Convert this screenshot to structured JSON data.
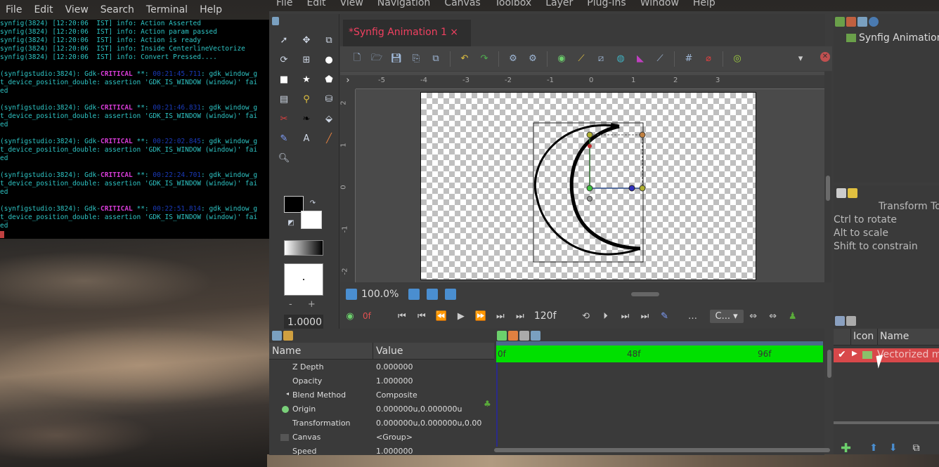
{
  "terminal_menu": [
    "File",
    "Edit",
    "View",
    "Search",
    "Terminal",
    "Help"
  ],
  "terminal_lines": [
    {
      "type": "info",
      "text": "synfig(3824) [12:20:06  IST] info: Action Asserted"
    },
    {
      "type": "info",
      "text": "synfig(3824) [12:20:06  IST] info: Action param passed"
    },
    {
      "type": "info",
      "text": "synfig(3824) [12:20:06  IST] info: Action is ready"
    },
    {
      "type": "info",
      "text": "synfig(3824) [12:20:06  IST] info: Inside CenterlineVectorize"
    },
    {
      "type": "info",
      "text": "synfig(3824) [12:20:06  IST] info: Convert Pressed...."
    },
    {
      "type": "blank",
      "text": ""
    },
    {
      "type": "crit",
      "prefix": "(synfigstudio:3824): Gdk-",
      "crit": "CRITICAL",
      "mid": " **: ",
      "ts": "00:21:45.711",
      "rest": ": gdk_window_g"
    },
    {
      "type": "info",
      "text": "t_device_position_double: assertion 'GDK_IS_WINDOW (window)' fai"
    },
    {
      "type": "info",
      "text": "ed"
    },
    {
      "type": "blank",
      "text": ""
    },
    {
      "type": "crit",
      "prefix": "(synfigstudio:3824): Gdk-",
      "crit": "CRITICAL",
      "mid": " **: ",
      "ts": "00:21:46.831",
      "rest": ": gdk_window_g"
    },
    {
      "type": "info",
      "text": "t_device_position_double: assertion 'GDK_IS_WINDOW (window)' fai"
    },
    {
      "type": "info",
      "text": "ed"
    },
    {
      "type": "blank",
      "text": ""
    },
    {
      "type": "crit",
      "prefix": "(synfigstudio:3824): Gdk-",
      "crit": "CRITICAL",
      "mid": " **: ",
      "ts": "00:22:02.845",
      "rest": ": gdk_window_g"
    },
    {
      "type": "info",
      "text": "t_device_position_double: assertion 'GDK_IS_WINDOW (window)' fai"
    },
    {
      "type": "info",
      "text": "ed"
    },
    {
      "type": "blank",
      "text": ""
    },
    {
      "type": "crit",
      "prefix": "(synfigstudio:3824): Gdk-",
      "crit": "CRITICAL",
      "mid": " **: ",
      "ts": "00:22:24.701",
      "rest": ": gdk_window_g"
    },
    {
      "type": "info",
      "text": "t_device_position_double: assertion 'GDK_IS_WINDOW (window)' fai"
    },
    {
      "type": "info",
      "text": "ed"
    },
    {
      "type": "blank",
      "text": ""
    },
    {
      "type": "crit",
      "prefix": "(synfigstudio:3824): Gdk-",
      "crit": "CRITICAL",
      "mid": " **: ",
      "ts": "00:22:51.814",
      "rest": ": gdk_window_g"
    },
    {
      "type": "info",
      "text": "t_device_position_double: assertion 'GDK_IS_WINDOW (window)' fai"
    },
    {
      "type": "info",
      "text": "ed"
    }
  ],
  "synfig_menu": [
    "File",
    "Edit",
    "View",
    "Navigation",
    "Canvas",
    "Toolbox",
    "Layer",
    "Plug-Ins",
    "Window",
    "Help"
  ],
  "document": {
    "tab_title": "*Synfig Animation 1",
    "close_glyph": "×"
  },
  "ruler": {
    "h_ticks": [
      "-5",
      "-4",
      "-3",
      "-2",
      "-1",
      "0",
      "1",
      "2",
      "3"
    ],
    "v_ticks": [
      "2",
      "1",
      "0",
      "-1",
      "-2"
    ]
  },
  "zoom": {
    "value": "100.0%"
  },
  "playback": {
    "current_frame": "0f",
    "end_frame": "120f",
    "keyframe_lock": "C..."
  },
  "toolbox": {
    "brush_size_minus": "-",
    "brush_size_plus": "+",
    "width_value": "1.0000"
  },
  "params": {
    "col_name": "Name",
    "col_value": "Value",
    "rows": [
      {
        "name": "Z Depth",
        "value": "0.000000",
        "mark": "none"
      },
      {
        "name": "Opacity",
        "value": "1.000000",
        "mark": "none"
      },
      {
        "name": "Blend Method",
        "value": "Composite",
        "mark": "tri"
      },
      {
        "name": "Origin",
        "value": "0.000000u,0.000000u",
        "mark": "dot"
      },
      {
        "name": "Transformation",
        "value": "0.000000u,0.000000u,0.00",
        "mark": "none"
      },
      {
        "name": "Canvas",
        "value": "<Group>",
        "mark": "sq"
      },
      {
        "name": "Speed",
        "value": "1.000000",
        "mark": "none"
      }
    ]
  },
  "timetrack": {
    "labels": [
      "0f",
      "48f",
      "96f"
    ]
  },
  "canvas_browser": {
    "item": "Synfig Animation"
  },
  "tool_options": {
    "title": "Transform To",
    "hints": [
      "Ctrl to rotate",
      "Alt to scale",
      "Shift to constrain"
    ]
  },
  "layers": {
    "col_icon": "Icon",
    "col_name": "Name",
    "layer_name": "Vectorized m"
  },
  "colors": {
    "accent": "#f04060",
    "timebar": "#00e000",
    "layer_selected": "#d8484a"
  }
}
